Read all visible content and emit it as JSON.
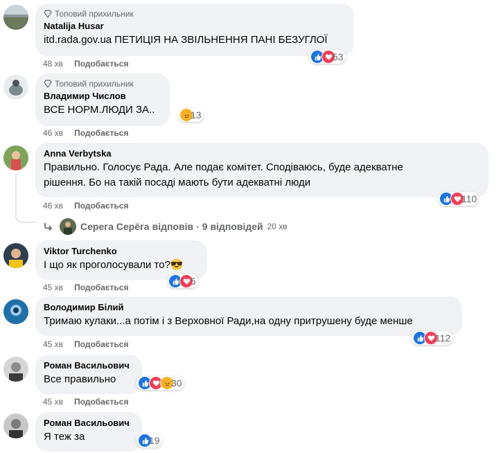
{
  "comments": [
    {
      "badge": "Топовий прихильник",
      "author": "Natalija Husar",
      "text": "itd.rada.gov.ua ПЕТИЦІЯ НА ЗВІЛЬНЕННЯ ПАНІ БЕЗУГЛОЇ",
      "time": "48 хв",
      "like": "Подобається",
      "count": "53",
      "reactions": [
        "like",
        "love"
      ]
    },
    {
      "badge": "Топовий прихильник",
      "author": "Владимир Числов",
      "text": "ВСЕ НОРМ.ЛЮДИ ЗА..",
      "time": "46 хв",
      "like": "Подобається",
      "count": "13",
      "reactions": [
        "angry"
      ]
    },
    {
      "author": "Anna Verbytska",
      "text_line1": "Правильно. Голосує Рада. Але подає комітет. Сподіваюсь, буде адекватне",
      "text_line2": "рішення. Бо на такій посаді мають бути адекватні люди",
      "time": "46 хв",
      "like": "Подобається",
      "count": "110",
      "reactions": [
        "like",
        "love"
      ]
    },
    {
      "author": "Viktor Turchenko",
      "text": "І що як проголосували то?😎",
      "time": "45 хв",
      "like": "Подобається",
      "count": "5",
      "reactions": [
        "like",
        "love"
      ]
    },
    {
      "author": "Володимир Білий",
      "text": "Тримаю кулаки...а потім і з Верховної Ради,на одну притрушену буде менше",
      "time": "45 хв",
      "like": "Подобається",
      "count": "112",
      "reactions": [
        "like",
        "love"
      ]
    },
    {
      "author": "Роман Васильович",
      "text": "Все правильно",
      "time": "45 хв",
      "like": "Подобається",
      "count": "30",
      "reactions": [
        "like",
        "love",
        "angry"
      ]
    },
    {
      "author": "Роман Васильович",
      "text": "Я теж за",
      "count": "19",
      "reactions": [
        "like"
      ]
    }
  ],
  "reply_summary": {
    "name": "Серега Серёга",
    "action": "відповів",
    "dot": "·",
    "count": "9 відповідей",
    "time": "20 хв"
  },
  "colors": {
    "like": "#1b74e4",
    "love": "#f33e58",
    "angry": "#f7b125",
    "bubble": "#f0f2f5",
    "meta": "#65676b"
  }
}
